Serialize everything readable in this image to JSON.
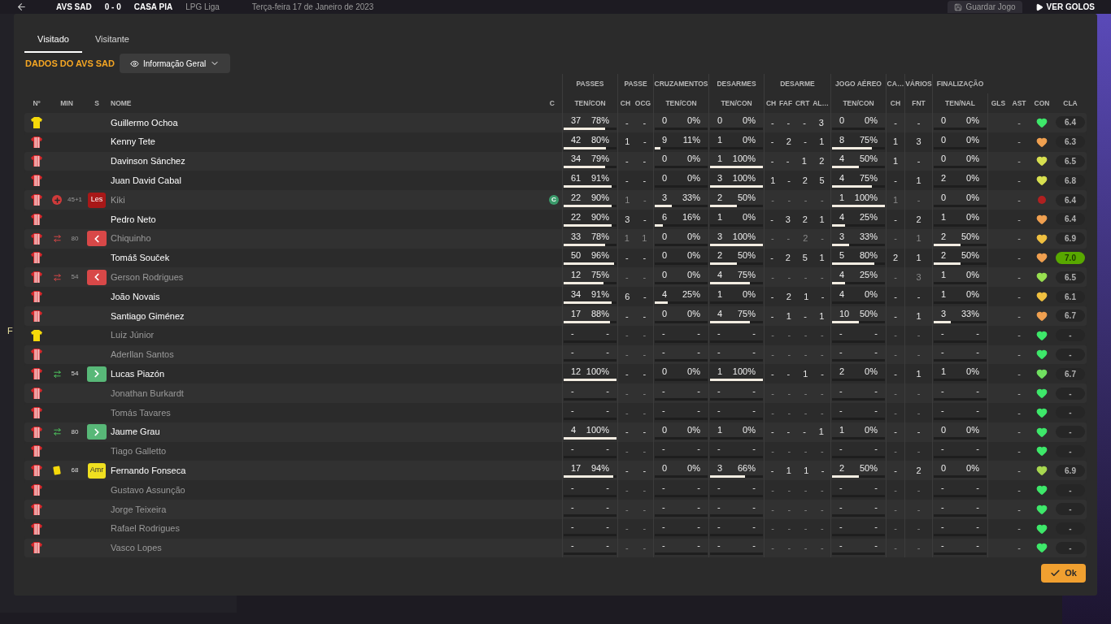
{
  "top_bar": {
    "home": "AVS SAD",
    "score": "0 - 0",
    "away": "CASA PIA",
    "competition": "LPG Liga",
    "date": "Terça-feira 17 de Janeiro de 2023",
    "save": "Guardar Jogo",
    "goals": "VER GOLOS"
  },
  "side_letter": "F",
  "tabs": [
    {
      "label": "Visitado",
      "selected": true
    },
    {
      "label": "Visitante",
      "selected": false
    }
  ],
  "section_title": "DADOS DO AVS SAD",
  "view_dropdown": "Informação Geral",
  "columns_left": [
    "Nº",
    "MIN",
    "S",
    "NOME",
    "C"
  ],
  "groups": [
    {
      "label": "PASSES",
      "subs": [
        "TEN/CON"
      ]
    },
    {
      "label": "PASSE",
      "subs": [
        "CH",
        "OCG"
      ]
    },
    {
      "label": "CRUZAMENTOS",
      "subs": [
        "TEN/CON"
      ]
    },
    {
      "label": "DESARMES",
      "subs": [
        "TEN/CON"
      ]
    },
    {
      "label": "DESARME",
      "subs": [
        "CH",
        "FAF",
        "CRT",
        "AL…"
      ]
    },
    {
      "label": "JOGO AÉREO",
      "subs": [
        "TEN/CON"
      ]
    },
    {
      "label": "CA…",
      "subs": [
        "CH"
      ]
    },
    {
      "label": "VÁRIOS",
      "subs": [
        "FNT"
      ]
    },
    {
      "label": "FINALIZAÇÃO",
      "subs": [
        "TEN/NAL"
      ]
    }
  ],
  "columns_right": [
    "GLS",
    "AST",
    "CON",
    "CLA"
  ],
  "rows": [
    {
      "kind": "goalkeeper",
      "name": "Guillermo Ochoa",
      "active": true,
      "stats": [
        {
          "kind": "ratio",
          "a": "37",
          "b": "78%",
          "level": 0.78
        },
        {
          "kind": "multi",
          "values": [
            "-",
            "-"
          ]
        },
        {
          "kind": "ratio",
          "a": "0",
          "b": "0%",
          "level": 0
        },
        {
          "kind": "ratio",
          "a": "0",
          "b": "0%",
          "level": 0
        },
        {
          "kind": "multi",
          "values": [
            "-",
            "-",
            "-",
            "3"
          ]
        },
        {
          "kind": "ratio",
          "a": "0",
          "b": "0%",
          "level": 0
        },
        {
          "kind": "multi",
          "values": [
            "-"
          ]
        },
        {
          "kind": "multi",
          "values": [
            "-"
          ]
        },
        {
          "kind": "ratio",
          "a": "0",
          "b": "0%",
          "level": 0
        }
      ],
      "ast": "-",
      "condition": {
        "kind": "heart",
        "color": "#3ee86a"
      },
      "rating": "6.4",
      "best": false
    },
    {
      "kind": "outfield",
      "name": "Kenny Tete",
      "active": true,
      "stats": [
        {
          "kind": "ratio",
          "a": "42",
          "b": "80%",
          "level": 0.8
        },
        {
          "kind": "multi",
          "values": [
            "1",
            "-"
          ]
        },
        {
          "kind": "ratio",
          "a": "9",
          "b": "11%",
          "level": 0.11
        },
        {
          "kind": "ratio",
          "a": "1",
          "b": "0%",
          "level": 0
        },
        {
          "kind": "multi",
          "values": [
            "-",
            "2",
            "-",
            "1"
          ]
        },
        {
          "kind": "ratio",
          "a": "8",
          "b": "75%",
          "level": 0.75
        },
        {
          "kind": "multi",
          "values": [
            "1"
          ]
        },
        {
          "kind": "multi",
          "values": [
            "3"
          ]
        },
        {
          "kind": "ratio",
          "a": "0",
          "b": "0%",
          "level": 0
        }
      ],
      "ast": "-",
      "condition": {
        "kind": "heart",
        "color": "#f0a050"
      },
      "rating": "6.3",
      "best": false
    },
    {
      "kind": "outfield",
      "name": "Davinson Sánchez",
      "active": true,
      "stats": [
        {
          "kind": "ratio",
          "a": "34",
          "b": "79%",
          "level": 0.79
        },
        {
          "kind": "multi",
          "values": [
            "-",
            "-"
          ]
        },
        {
          "kind": "ratio",
          "a": "0",
          "b": "0%",
          "level": 0
        },
        {
          "kind": "ratio",
          "a": "1",
          "b": "100%",
          "level": 1
        },
        {
          "kind": "multi",
          "values": [
            "-",
            "-",
            "1",
            "2"
          ]
        },
        {
          "kind": "ratio",
          "a": "4",
          "b": "50%",
          "level": 0.5
        },
        {
          "kind": "multi",
          "values": [
            "1"
          ]
        },
        {
          "kind": "multi",
          "values": [
            "-"
          ]
        },
        {
          "kind": "ratio",
          "a": "0",
          "b": "0%",
          "level": 0
        }
      ],
      "ast": "-",
      "condition": {
        "kind": "heart",
        "color": "#d8e050"
      },
      "rating": "6.5",
      "best": false
    },
    {
      "kind": "outfield",
      "name": "Juan David Cabal",
      "active": true,
      "stats": [
        {
          "kind": "ratio",
          "a": "61",
          "b": "91%",
          "level": 0.91
        },
        {
          "kind": "multi",
          "values": [
            "-",
            "-"
          ]
        },
        {
          "kind": "ratio",
          "a": "0",
          "b": "0%",
          "level": 0
        },
        {
          "kind": "ratio",
          "a": "3",
          "b": "100%",
          "level": 1
        },
        {
          "kind": "multi",
          "values": [
            "1",
            "-",
            "2",
            "5"
          ]
        },
        {
          "kind": "ratio",
          "a": "4",
          "b": "75%",
          "level": 0.75
        },
        {
          "kind": "multi",
          "values": [
            "-"
          ]
        },
        {
          "kind": "multi",
          "values": [
            "1"
          ]
        },
        {
          "kind": "ratio",
          "a": "2",
          "b": "0%",
          "level": 0
        }
      ],
      "ast": "-",
      "condition": {
        "kind": "heart",
        "color": "#d8e050"
      },
      "rating": "6.8",
      "best": false
    },
    {
      "kind": "outfield",
      "event": {
        "kind": "injury"
      },
      "minute": "45+1",
      "badge": {
        "kind": "injury",
        "text": "Les"
      },
      "name": "Kiki",
      "active": false,
      "captain": "C",
      "stats": [
        {
          "kind": "ratio",
          "a": "22",
          "b": "90%",
          "level": 0.9
        },
        {
          "kind": "multi",
          "values": [
            "1",
            "-"
          ]
        },
        {
          "kind": "ratio",
          "a": "3",
          "b": "33%",
          "level": 0.33
        },
        {
          "kind": "ratio",
          "a": "2",
          "b": "50%",
          "level": 0.5
        },
        {
          "kind": "multi",
          "values": [
            "-",
            "-",
            "-",
            "-"
          ]
        },
        {
          "kind": "ratio",
          "a": "1",
          "b": "100%",
          "level": 1
        },
        {
          "kind": "multi",
          "values": [
            "1"
          ]
        },
        {
          "kind": "multi",
          "values": [
            "-"
          ]
        },
        {
          "kind": "ratio",
          "a": "0",
          "b": "0%",
          "level": 0
        }
      ],
      "ast": "-",
      "condition": {
        "kind": "injury",
        "color": "#b02020"
      },
      "rating": "6.4",
      "best": false
    },
    {
      "kind": "outfield",
      "name": "Pedro Neto",
      "active": true,
      "stats": [
        {
          "kind": "ratio",
          "a": "22",
          "b": "90%",
          "level": 0.9
        },
        {
          "kind": "multi",
          "values": [
            "3",
            "-"
          ]
        },
        {
          "kind": "ratio",
          "a": "6",
          "b": "16%",
          "level": 0.16
        },
        {
          "kind": "ratio",
          "a": "1",
          "b": "0%",
          "level": 0
        },
        {
          "kind": "multi",
          "values": [
            "-",
            "3",
            "2",
            "1"
          ]
        },
        {
          "kind": "ratio",
          "a": "4",
          "b": "25%",
          "level": 0.25
        },
        {
          "kind": "multi",
          "values": [
            "-"
          ]
        },
        {
          "kind": "multi",
          "values": [
            "2"
          ]
        },
        {
          "kind": "ratio",
          "a": "1",
          "b": "0%",
          "level": 0
        }
      ],
      "ast": "-",
      "condition": {
        "kind": "heart",
        "color": "#f0a050"
      },
      "rating": "6.4",
      "best": false
    },
    {
      "kind": "outfield",
      "event": {
        "kind": "sub_off"
      },
      "minute": "80",
      "badge": {
        "kind": "off"
      },
      "name": "Chiquinho",
      "active": false,
      "stats": [
        {
          "kind": "ratio",
          "a": "33",
          "b": "78%",
          "level": 0.78
        },
        {
          "kind": "multi",
          "values": [
            "1",
            "1"
          ]
        },
        {
          "kind": "ratio",
          "a": "0",
          "b": "0%",
          "level": 0
        },
        {
          "kind": "ratio",
          "a": "3",
          "b": "100%",
          "level": 1
        },
        {
          "kind": "multi",
          "values": [
            "-",
            "-",
            "2",
            "-"
          ]
        },
        {
          "kind": "ratio",
          "a": "3",
          "b": "33%",
          "level": 0.33
        },
        {
          "kind": "multi",
          "values": [
            "-"
          ]
        },
        {
          "kind": "multi",
          "values": [
            "1"
          ]
        },
        {
          "kind": "ratio",
          "a": "2",
          "b": "50%",
          "level": 0.5
        }
      ],
      "ast": "-",
      "condition": {
        "kind": "heart",
        "color": "#f0c040"
      },
      "rating": "6.9",
      "best": false
    },
    {
      "kind": "outfield",
      "name": "Tomáš Souček",
      "active": true,
      "stats": [
        {
          "kind": "ratio",
          "a": "50",
          "b": "96%",
          "level": 0.96
        },
        {
          "kind": "multi",
          "values": [
            "-",
            "-"
          ]
        },
        {
          "kind": "ratio",
          "a": "0",
          "b": "0%",
          "level": 0
        },
        {
          "kind": "ratio",
          "a": "2",
          "b": "50%",
          "level": 0.5
        },
        {
          "kind": "multi",
          "values": [
            "-",
            "2",
            "5",
            "1"
          ]
        },
        {
          "kind": "ratio",
          "a": "5",
          "b": "80%",
          "level": 0.8
        },
        {
          "kind": "multi",
          "values": [
            "2"
          ]
        },
        {
          "kind": "multi",
          "values": [
            "1"
          ]
        },
        {
          "kind": "ratio",
          "a": "2",
          "b": "50%",
          "level": 0.5
        }
      ],
      "ast": "-",
      "condition": {
        "kind": "heart",
        "color": "#f0a050"
      },
      "rating": "7.0",
      "best": true
    },
    {
      "kind": "outfield",
      "event": {
        "kind": "sub_off"
      },
      "minute": "54",
      "badge": {
        "kind": "off"
      },
      "name": "Gerson Rodrigues",
      "active": false,
      "stats": [
        {
          "kind": "ratio",
          "a": "12",
          "b": "75%",
          "level": 0.75
        },
        {
          "kind": "multi",
          "values": [
            "-",
            "-"
          ]
        },
        {
          "kind": "ratio",
          "a": "0",
          "b": "0%",
          "level": 0
        },
        {
          "kind": "ratio",
          "a": "4",
          "b": "75%",
          "level": 0.75
        },
        {
          "kind": "multi",
          "values": [
            "-",
            "-",
            "-",
            "-"
          ]
        },
        {
          "kind": "ratio",
          "a": "4",
          "b": "25%",
          "level": 0.25
        },
        {
          "kind": "multi",
          "values": [
            "-"
          ]
        },
        {
          "kind": "multi",
          "values": [
            "3"
          ]
        },
        {
          "kind": "ratio",
          "a": "1",
          "b": "0%",
          "level": 0
        }
      ],
      "ast": "-",
      "condition": {
        "kind": "heart",
        "color": "#98e050"
      },
      "rating": "6.5",
      "best": false
    },
    {
      "kind": "outfield",
      "name": "João Novais",
      "active": true,
      "stats": [
        {
          "kind": "ratio",
          "a": "34",
          "b": "91%",
          "level": 0.91
        },
        {
          "kind": "multi",
          "values": [
            "6",
            "-"
          ]
        },
        {
          "kind": "ratio",
          "a": "4",
          "b": "25%",
          "level": 0.25
        },
        {
          "kind": "ratio",
          "a": "1",
          "b": "0%",
          "level": 0
        },
        {
          "kind": "multi",
          "values": [
            "-",
            "2",
            "1",
            "-"
          ]
        },
        {
          "kind": "ratio",
          "a": "4",
          "b": "0%",
          "level": 0
        },
        {
          "kind": "multi",
          "values": [
            "-"
          ]
        },
        {
          "kind": "multi",
          "values": [
            "-"
          ]
        },
        {
          "kind": "ratio",
          "a": "1",
          "b": "0%",
          "level": 0
        }
      ],
      "ast": "-",
      "condition": {
        "kind": "heart",
        "color": "#f0c040"
      },
      "rating": "6.1",
      "best": false
    },
    {
      "kind": "outfield",
      "name": "Santiago Giménez",
      "active": true,
      "stats": [
        {
          "kind": "ratio",
          "a": "17",
          "b": "88%",
          "level": 0.88
        },
        {
          "kind": "multi",
          "values": [
            "-",
            "-"
          ]
        },
        {
          "kind": "ratio",
          "a": "0",
          "b": "0%",
          "level": 0
        },
        {
          "kind": "ratio",
          "a": "4",
          "b": "75%",
          "level": 0.75
        },
        {
          "kind": "multi",
          "values": [
            "-",
            "1",
            "-",
            "1"
          ]
        },
        {
          "kind": "ratio",
          "a": "10",
          "b": "50%",
          "level": 0.5
        },
        {
          "kind": "multi",
          "values": [
            "-"
          ]
        },
        {
          "kind": "multi",
          "values": [
            "1"
          ]
        },
        {
          "kind": "ratio",
          "a": "3",
          "b": "33%",
          "level": 0.33
        }
      ],
      "ast": "-",
      "condition": {
        "kind": "heart",
        "color": "#f0a050"
      },
      "rating": "6.7",
      "best": false
    },
    {
      "kind": "goalkeeper",
      "name": "Luiz Júnior",
      "active": false,
      "stats": [
        {
          "kind": "ratio",
          "a": "-",
          "b": "-",
          "level": 0
        },
        {
          "kind": "multi",
          "values": [
            "-",
            "-"
          ]
        },
        {
          "kind": "ratio",
          "a": "-",
          "b": "-",
          "level": 0
        },
        {
          "kind": "ratio",
          "a": "-",
          "b": "-",
          "level": 0
        },
        {
          "kind": "multi",
          "values": [
            "-",
            "-",
            "-",
            "-"
          ]
        },
        {
          "kind": "ratio",
          "a": "-",
          "b": "-",
          "level": 0
        },
        {
          "kind": "multi",
          "values": [
            "-"
          ]
        },
        {
          "kind": "multi",
          "values": [
            "-"
          ]
        },
        {
          "kind": "ratio",
          "a": "-",
          "b": "-",
          "level": 0
        }
      ],
      "ast": "-",
      "condition": {
        "kind": "heart",
        "color": "#3ee86a"
      },
      "rating": "-",
      "best": false
    },
    {
      "kind": "outfield",
      "name": "Aderllan Santos",
      "active": false,
      "stats": [
        {
          "kind": "ratio",
          "a": "-",
          "b": "-",
          "level": 0
        },
        {
          "kind": "multi",
          "values": [
            "-",
            "-"
          ]
        },
        {
          "kind": "ratio",
          "a": "-",
          "b": "-",
          "level": 0
        },
        {
          "kind": "ratio",
          "a": "-",
          "b": "-",
          "level": 0
        },
        {
          "kind": "multi",
          "values": [
            "-",
            "-",
            "-",
            "-"
          ]
        },
        {
          "kind": "ratio",
          "a": "-",
          "b": "-",
          "level": 0
        },
        {
          "kind": "multi",
          "values": [
            "-"
          ]
        },
        {
          "kind": "multi",
          "values": [
            "-"
          ]
        },
        {
          "kind": "ratio",
          "a": "-",
          "b": "-",
          "level": 0
        }
      ],
      "ast": "-",
      "condition": {
        "kind": "heart",
        "color": "#3ee86a"
      },
      "rating": "-",
      "best": false
    },
    {
      "kind": "outfield",
      "event": {
        "kind": "sub_on"
      },
      "minute": "54",
      "badge": {
        "kind": "on"
      },
      "name": "Lucas Piazón",
      "active": true,
      "stats": [
        {
          "kind": "ratio",
          "a": "12",
          "b": "100%",
          "level": 1
        },
        {
          "kind": "multi",
          "values": [
            "-",
            "-"
          ]
        },
        {
          "kind": "ratio",
          "a": "0",
          "b": "0%",
          "level": 0
        },
        {
          "kind": "ratio",
          "a": "1",
          "b": "100%",
          "level": 1
        },
        {
          "kind": "multi",
          "values": [
            "-",
            "-",
            "1",
            "-"
          ]
        },
        {
          "kind": "ratio",
          "a": "2",
          "b": "0%",
          "level": 0
        },
        {
          "kind": "multi",
          "values": [
            "-"
          ]
        },
        {
          "kind": "multi",
          "values": [
            "1"
          ]
        },
        {
          "kind": "ratio",
          "a": "1",
          "b": "0%",
          "level": 0
        }
      ],
      "ast": "-",
      "condition": {
        "kind": "heart",
        "color": "#70e060"
      },
      "rating": "6.7",
      "best": false
    },
    {
      "kind": "outfield",
      "name": "Jonathan Burkardt",
      "active": false,
      "stats": [
        {
          "kind": "ratio",
          "a": "-",
          "b": "-",
          "level": 0
        },
        {
          "kind": "multi",
          "values": [
            "-",
            "-"
          ]
        },
        {
          "kind": "ratio",
          "a": "-",
          "b": "-",
          "level": 0
        },
        {
          "kind": "ratio",
          "a": "-",
          "b": "-",
          "level": 0
        },
        {
          "kind": "multi",
          "values": [
            "-",
            "-",
            "-",
            "-"
          ]
        },
        {
          "kind": "ratio",
          "a": "-",
          "b": "-",
          "level": 0
        },
        {
          "kind": "multi",
          "values": [
            "-"
          ]
        },
        {
          "kind": "multi",
          "values": [
            "-"
          ]
        },
        {
          "kind": "ratio",
          "a": "-",
          "b": "-",
          "level": 0
        }
      ],
      "ast": "-",
      "condition": {
        "kind": "heart",
        "color": "#3ee86a"
      },
      "rating": "-",
      "best": false
    },
    {
      "kind": "outfield",
      "name": "Tomás Tavares",
      "active": false,
      "stats": [
        {
          "kind": "ratio",
          "a": "-",
          "b": "-",
          "level": 0
        },
        {
          "kind": "multi",
          "values": [
            "-",
            "-"
          ]
        },
        {
          "kind": "ratio",
          "a": "-",
          "b": "-",
          "level": 0
        },
        {
          "kind": "ratio",
          "a": "-",
          "b": "-",
          "level": 0
        },
        {
          "kind": "multi",
          "values": [
            "-",
            "-",
            "-",
            "-"
          ]
        },
        {
          "kind": "ratio",
          "a": "-",
          "b": "-",
          "level": 0
        },
        {
          "kind": "multi",
          "values": [
            "-"
          ]
        },
        {
          "kind": "multi",
          "values": [
            "-"
          ]
        },
        {
          "kind": "ratio",
          "a": "-",
          "b": "-",
          "level": 0
        }
      ],
      "ast": "-",
      "condition": {
        "kind": "heart",
        "color": "#3ee86a"
      },
      "rating": "-",
      "best": false
    },
    {
      "kind": "outfield",
      "event": {
        "kind": "sub_on"
      },
      "minute": "80",
      "badge": {
        "kind": "on"
      },
      "name": "Jaume Grau",
      "active": true,
      "stats": [
        {
          "kind": "ratio",
          "a": "4",
          "b": "100%",
          "level": 1
        },
        {
          "kind": "multi",
          "values": [
            "-",
            "-"
          ]
        },
        {
          "kind": "ratio",
          "a": "0",
          "b": "0%",
          "level": 0
        },
        {
          "kind": "ratio",
          "a": "1",
          "b": "0%",
          "level": 0
        },
        {
          "kind": "multi",
          "values": [
            "-",
            "-",
            "-",
            "1"
          ]
        },
        {
          "kind": "ratio",
          "a": "1",
          "b": "0%",
          "level": 0
        },
        {
          "kind": "multi",
          "values": [
            "-"
          ]
        },
        {
          "kind": "multi",
          "values": [
            "-"
          ]
        },
        {
          "kind": "ratio",
          "a": "0",
          "b": "0%",
          "level": 0
        }
      ],
      "ast": "-",
      "condition": {
        "kind": "heart",
        "color": "#3ee86a"
      },
      "rating": "-",
      "best": false
    },
    {
      "kind": "outfield",
      "name": "Tiago Galletto",
      "active": false,
      "stats": [
        {
          "kind": "ratio",
          "a": "-",
          "b": "-",
          "level": 0
        },
        {
          "kind": "multi",
          "values": [
            "-",
            "-"
          ]
        },
        {
          "kind": "ratio",
          "a": "-",
          "b": "-",
          "level": 0
        },
        {
          "kind": "ratio",
          "a": "-",
          "b": "-",
          "level": 0
        },
        {
          "kind": "multi",
          "values": [
            "-",
            "-",
            "-",
            "-"
          ]
        },
        {
          "kind": "ratio",
          "a": "-",
          "b": "-",
          "level": 0
        },
        {
          "kind": "multi",
          "values": [
            "-"
          ]
        },
        {
          "kind": "multi",
          "values": [
            "-"
          ]
        },
        {
          "kind": "ratio",
          "a": "-",
          "b": "-",
          "level": 0
        }
      ],
      "ast": "-",
      "condition": {
        "kind": "heart",
        "color": "#3ee86a"
      },
      "rating": "-",
      "best": false
    },
    {
      "kind": "outfield",
      "event": {
        "kind": "booking"
      },
      "minute": "68",
      "badge": {
        "kind": "booking",
        "text": "Amr"
      },
      "name": "Fernando Fonseca",
      "active": true,
      "stats": [
        {
          "kind": "ratio",
          "a": "17",
          "b": "94%",
          "level": 0.94
        },
        {
          "kind": "multi",
          "values": [
            "-",
            "-"
          ]
        },
        {
          "kind": "ratio",
          "a": "0",
          "b": "0%",
          "level": 0
        },
        {
          "kind": "ratio",
          "a": "3",
          "b": "66%",
          "level": 0.66
        },
        {
          "kind": "multi",
          "values": [
            "-",
            "1",
            "1",
            "-"
          ]
        },
        {
          "kind": "ratio",
          "a": "2",
          "b": "50%",
          "level": 0.5
        },
        {
          "kind": "multi",
          "values": [
            "-"
          ]
        },
        {
          "kind": "multi",
          "values": [
            "2"
          ]
        },
        {
          "kind": "ratio",
          "a": "0",
          "b": "0%",
          "level": 0
        }
      ],
      "ast": "-",
      "condition": {
        "kind": "heart",
        "color": "#a8d850"
      },
      "rating": "6.9",
      "best": false
    },
    {
      "kind": "outfield",
      "name": "Gustavo Assunção",
      "active": false,
      "stats": [
        {
          "kind": "ratio",
          "a": "-",
          "b": "-",
          "level": 0
        },
        {
          "kind": "multi",
          "values": [
            "-",
            "-"
          ]
        },
        {
          "kind": "ratio",
          "a": "-",
          "b": "-",
          "level": 0
        },
        {
          "kind": "ratio",
          "a": "-",
          "b": "-",
          "level": 0
        },
        {
          "kind": "multi",
          "values": [
            "-",
            "-",
            "-",
            "-"
          ]
        },
        {
          "kind": "ratio",
          "a": "-",
          "b": "-",
          "level": 0
        },
        {
          "kind": "multi",
          "values": [
            "-"
          ]
        },
        {
          "kind": "multi",
          "values": [
            "-"
          ]
        },
        {
          "kind": "ratio",
          "a": "-",
          "b": "-",
          "level": 0
        }
      ],
      "ast": "-",
      "condition": {
        "kind": "heart",
        "color": "#3ee86a"
      },
      "rating": "-",
      "best": false
    },
    {
      "kind": "outfield",
      "name": "Jorge Teixeira",
      "active": false,
      "stats": [
        {
          "kind": "ratio",
          "a": "-",
          "b": "-",
          "level": 0
        },
        {
          "kind": "multi",
          "values": [
            "-",
            "-"
          ]
        },
        {
          "kind": "ratio",
          "a": "-",
          "b": "-",
          "level": 0
        },
        {
          "kind": "ratio",
          "a": "-",
          "b": "-",
          "level": 0
        },
        {
          "kind": "multi",
          "values": [
            "-",
            "-",
            "-",
            "-"
          ]
        },
        {
          "kind": "ratio",
          "a": "-",
          "b": "-",
          "level": 0
        },
        {
          "kind": "multi",
          "values": [
            "-"
          ]
        },
        {
          "kind": "multi",
          "values": [
            "-"
          ]
        },
        {
          "kind": "ratio",
          "a": "-",
          "b": "-",
          "level": 0
        }
      ],
      "ast": "-",
      "condition": {
        "kind": "heart",
        "color": "#3ee86a"
      },
      "rating": "-",
      "best": false
    },
    {
      "kind": "outfield",
      "name": "Rafael Rodrigues",
      "active": false,
      "stats": [
        {
          "kind": "ratio",
          "a": "-",
          "b": "-",
          "level": 0
        },
        {
          "kind": "multi",
          "values": [
            "-",
            "-"
          ]
        },
        {
          "kind": "ratio",
          "a": "-",
          "b": "-",
          "level": 0
        },
        {
          "kind": "ratio",
          "a": "-",
          "b": "-",
          "level": 0
        },
        {
          "kind": "multi",
          "values": [
            "-",
            "-",
            "-",
            "-"
          ]
        },
        {
          "kind": "ratio",
          "a": "-",
          "b": "-",
          "level": 0
        },
        {
          "kind": "multi",
          "values": [
            "-"
          ]
        },
        {
          "kind": "multi",
          "values": [
            "-"
          ]
        },
        {
          "kind": "ratio",
          "a": "-",
          "b": "-",
          "level": 0
        }
      ],
      "ast": "-",
      "condition": {
        "kind": "heart",
        "color": "#3ee86a"
      },
      "rating": "-",
      "best": false
    },
    {
      "kind": "outfield",
      "name": "Vasco Lopes",
      "active": false,
      "stats": [
        {
          "kind": "ratio",
          "a": "-",
          "b": "-",
          "level": 0
        },
        {
          "kind": "multi",
          "values": [
            "-",
            "-"
          ]
        },
        {
          "kind": "ratio",
          "a": "-",
          "b": "-",
          "level": 0
        },
        {
          "kind": "ratio",
          "a": "-",
          "b": "-",
          "level": 0
        },
        {
          "kind": "multi",
          "values": [
            "-",
            "-",
            "-",
            "-"
          ]
        },
        {
          "kind": "ratio",
          "a": "-",
          "b": "-",
          "level": 0
        },
        {
          "kind": "multi",
          "values": [
            "-"
          ]
        },
        {
          "kind": "multi",
          "values": [
            "-"
          ]
        },
        {
          "kind": "ratio",
          "a": "-",
          "b": "-",
          "level": 0
        }
      ],
      "ast": "-",
      "condition": {
        "kind": "heart",
        "color": "#3ee86a"
      },
      "rating": "-",
      "best": false
    }
  ],
  "ok_button": "Ok"
}
